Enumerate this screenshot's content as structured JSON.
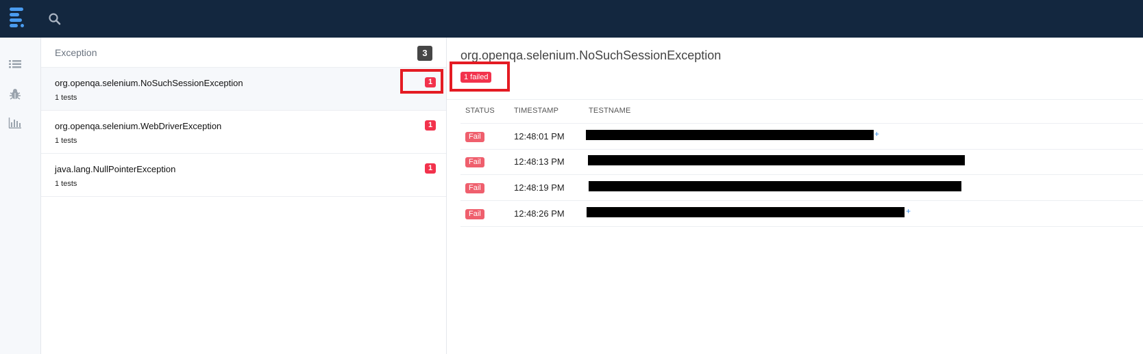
{
  "topbar": {
    "logo_icon": "logo-icon",
    "search_icon": "search-icon"
  },
  "rail": {
    "icons": [
      "list-icon",
      "bug-icon",
      "bar-chart-icon"
    ]
  },
  "exceptions": {
    "header": "Exception",
    "count": "3",
    "items": [
      {
        "name": "org.openqa.selenium.NoSuchSessionException",
        "tests": "1 tests",
        "failed": "1"
      },
      {
        "name": "org.openqa.selenium.WebDriverException",
        "tests": "1 tests",
        "failed": "1"
      },
      {
        "name": "java.lang.NullPointerException",
        "tests": "1 tests",
        "failed": "1"
      }
    ]
  },
  "detail": {
    "title": "org.openqa.selenium.NoSuchSessionException",
    "failed_badge": "1 failed",
    "columns": [
      "STATUS",
      "TIMESTAMP",
      "TESTNAME"
    ],
    "rows": [
      {
        "status": "Fail",
        "timestamp": "12:48:01 PM"
      },
      {
        "status": "Fail",
        "timestamp": "12:48:13 PM"
      },
      {
        "status": "Fail",
        "timestamp": "12:48:19 PM"
      },
      {
        "status": "Fail",
        "timestamp": "12:48:26 PM"
      }
    ]
  },
  "colors": {
    "topbar": "#13273f",
    "fail_badge": "#f2324c",
    "status_fail": "#ef5f6d",
    "highlight": "#e41b23"
  }
}
